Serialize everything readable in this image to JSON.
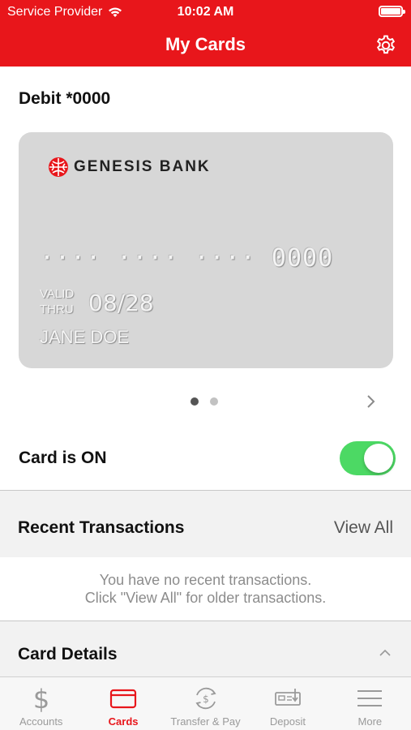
{
  "status_bar": {
    "carrier": "Service Provider",
    "time": "10:02 AM"
  },
  "header": {
    "title": "My Cards"
  },
  "card_section": {
    "card_name": "Debit *0000",
    "card": {
      "bank_name": "GENESIS BANK",
      "number": "···· ···· ···· 0000",
      "valid_label_1": "VALID",
      "valid_label_2": "THRU",
      "expiry": "08/28",
      "holder": "JANE DOE"
    },
    "pager": {
      "count": 2,
      "active_index": 0
    }
  },
  "card_toggle": {
    "label": "Card is ON",
    "on": true
  },
  "recent_transactions": {
    "title": "Recent Transactions",
    "view_all": "View All",
    "empty_line_1": "You have no recent transactions.",
    "empty_line_2": "Click \"View All\" for older transactions."
  },
  "card_details": {
    "title": "Card Details"
  },
  "tabs": [
    {
      "label": "Accounts",
      "icon": "dollar-icon",
      "active": false
    },
    {
      "label": "Cards",
      "icon": "card-icon",
      "active": true
    },
    {
      "label": "Transfer & Pay",
      "icon": "transfer-icon",
      "active": false
    },
    {
      "label": "Deposit",
      "icon": "check-deposit-icon",
      "active": false
    },
    {
      "label": "More",
      "icon": "menu-icon",
      "active": false
    }
  ],
  "colors": {
    "brand_red": "#e8161b",
    "toggle_green": "#4cd964",
    "card_gray": "#d7d7d7"
  }
}
